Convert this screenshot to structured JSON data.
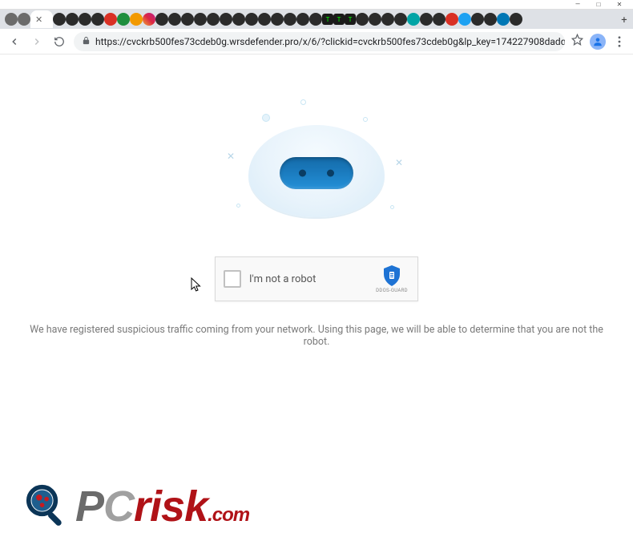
{
  "window": {
    "minimize": "—",
    "maximize": "□",
    "close": "✕"
  },
  "tabs": {
    "active_close": "✕",
    "new_tab": "+"
  },
  "toolbar": {
    "url": "https://cvckrb500fes73cdeb0g.wrsdefender.pro/x/6/?clickid=cvckrb500fes73cdeb0g&lp_key=174227908dadd9…"
  },
  "captcha": {
    "label": "I'm not a robot",
    "provider": "DDOS-GUARD"
  },
  "message": "We have registered suspicious traffic coming from your network. Using this page, we will be able to determine that you are not the robot.",
  "watermark": {
    "p": "P",
    "c": "C",
    "risk": "risk",
    "dotcom": ".com"
  }
}
